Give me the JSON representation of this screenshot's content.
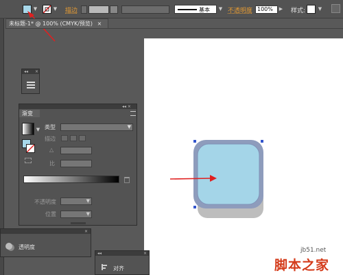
{
  "control_bar": {
    "stroke_label": "描边",
    "stroke_style_label": "基本",
    "opacity_label": "不透明度",
    "opacity_value": "100%",
    "style_label": "样式:"
  },
  "document_tab": {
    "title": "未标题-1* @ 100% (CMYK/预览)",
    "close": "×"
  },
  "gradient_panel": {
    "tab_label": "渐变",
    "type_label": "类型",
    "stroke_label": "描边",
    "angle_label": "△",
    "aspect_label": "比",
    "opacity_label": "不透明度",
    "location_label": "位置",
    "header_btns": "◂◂ ×"
  },
  "transparency_panel": {
    "label": "透明度"
  },
  "align_panel": {
    "label": "对齐"
  },
  "watermark": {
    "site": "jb51.net",
    "name": "脚本之家"
  },
  "colors": {
    "fill_swatch": "#a8d8ea",
    "accent_red": "#e02020",
    "icon_fill": "#a4d5e8",
    "icon_frame": "#8d9dba",
    "icon_base": "#c8c8c8"
  }
}
